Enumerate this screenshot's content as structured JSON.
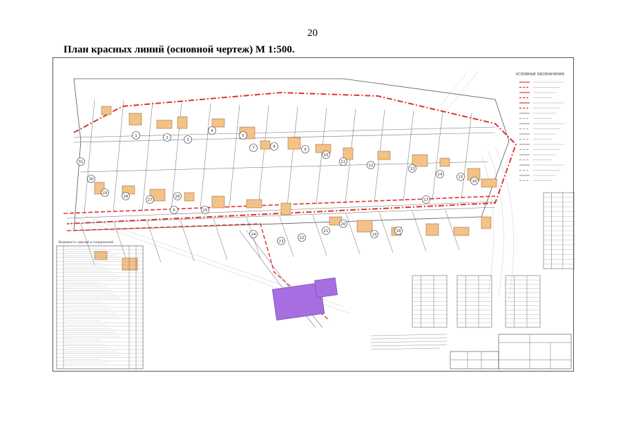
{
  "page": {
    "number": "20",
    "title": "План красных линий (основной чертеж) М 1:500."
  },
  "drawing": {
    "plot_numbers": [
      "1",
      "2",
      "3",
      "4",
      "5",
      "6",
      "7",
      "8",
      "9",
      "10",
      "11",
      "12",
      "13",
      "14",
      "15",
      "16",
      "17",
      "18",
      "19",
      "20",
      "21",
      "22",
      "23",
      "24",
      "25",
      "26",
      "27",
      "28",
      "29",
      "30",
      "31"
    ],
    "legend_title": "УСЛОВНЫЕ ОБОЗНАЧЕНИЯ",
    "table_title": "Ведомость зданий и сооружений",
    "colors": {
      "red_line": "#e0302a",
      "building_fill": "#f4c187",
      "building_stroke": "#8a5a2b",
      "planned_building": "#a66ee0",
      "ink": "#333333"
    }
  }
}
